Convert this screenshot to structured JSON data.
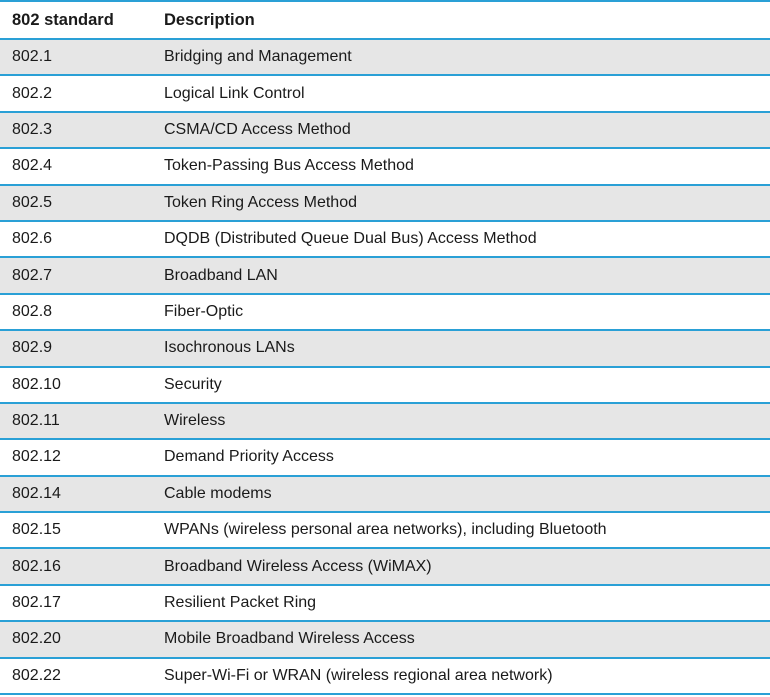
{
  "table": {
    "headers": {
      "standard": "802 standard",
      "description": "Description"
    },
    "rows": [
      {
        "standard": "802.1",
        "description": "Bridging and Management"
      },
      {
        "standard": "802.2",
        "description": "Logical Link Control"
      },
      {
        "standard": "802.3",
        "description": "CSMA/CD Access Method"
      },
      {
        "standard": "802.4",
        "description": "Token-Passing Bus Access Method"
      },
      {
        "standard": "802.5",
        "description": "Token Ring Access Method"
      },
      {
        "standard": "802.6",
        "description": "DQDB (Distributed Queue Dual Bus) Access Method"
      },
      {
        "standard": "802.7",
        "description": "Broadband LAN"
      },
      {
        "standard": "802.8",
        "description": "Fiber-Optic"
      },
      {
        "standard": "802.9",
        "description": "Isochronous LANs"
      },
      {
        "standard": "802.10",
        "description": "Security"
      },
      {
        "standard": "802.11",
        "description": "Wireless"
      },
      {
        "standard": "802.12",
        "description": "Demand Priority Access"
      },
      {
        "standard": "802.14",
        "description": "Cable modems"
      },
      {
        "standard": "802.15",
        "description": "WPANs (wireless personal area networks), including Bluetooth"
      },
      {
        "standard": "802.16",
        "description": "Broadband Wireless Access (WiMAX)"
      },
      {
        "standard": "802.17",
        "description": "Resilient Packet Ring"
      },
      {
        "standard": "802.20",
        "description": "Mobile Broadband Wireless Access"
      },
      {
        "standard": "802.22",
        "description": "Super-Wi-Fi or WRAN (wireless regional area network)"
      }
    ]
  },
  "colors": {
    "rule": "#2aa0d6",
    "shade": "#e6e6e6",
    "text": "#1a1a1a"
  }
}
